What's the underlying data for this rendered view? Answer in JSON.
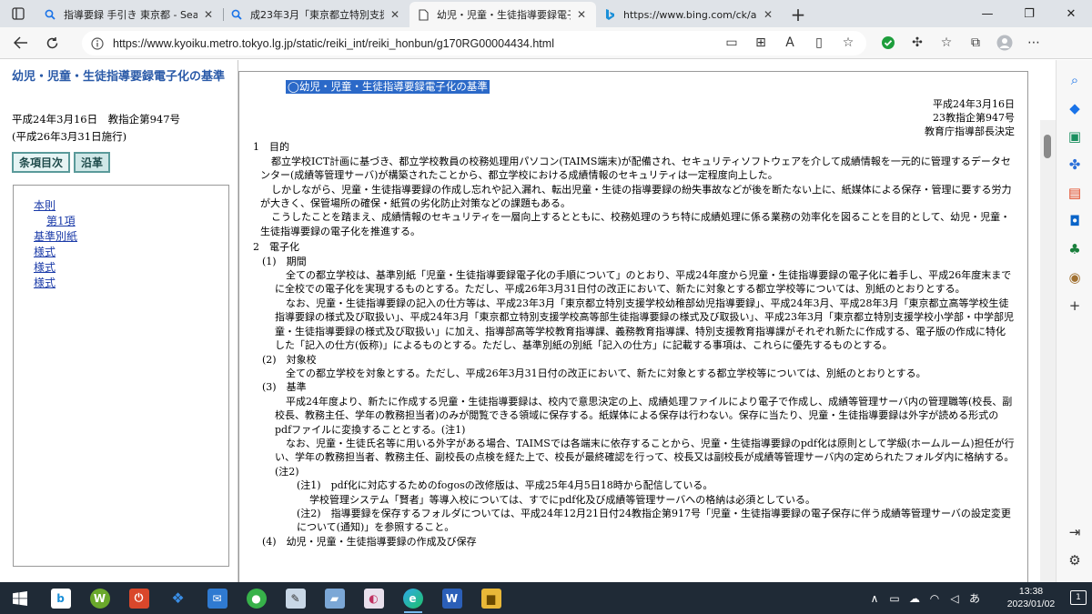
{
  "browser": {
    "tabs": [
      {
        "title": "指導要録 手引き 東京都 - Search",
        "icon": "search-icon",
        "active": false
      },
      {
        "title": "成23年3月「東京都立特別支援学校",
        "icon": "search-icon",
        "active": false
      },
      {
        "title": "幼児・児童・生徒指導要録電子化の",
        "icon": "page-icon",
        "active": true
      },
      {
        "title": "https://www.bing.com/ck/a?!&&",
        "icon": "bing-icon",
        "active": false
      }
    ],
    "url": "https://www.kyoiku.metro.tokyo.lg.jp/static/reiki_int/reiki_honbun/g170RG00004434.html"
  },
  "left": {
    "title": "幼児・児童・生徒指導要録電子化の基準",
    "date_line": "平成24年3月16日　教指企第947号",
    "enforce_line": "(平成26年3月31日施行)",
    "tab_toc": "条項目次",
    "tab_history": "沿革",
    "toc": [
      "本則",
      "第1項",
      "基準別紙",
      "様式",
      "様式",
      "様式"
    ]
  },
  "doc": {
    "title": "◯幼児・児童・生徒指導要録電子化の基準",
    "header": [
      "平成24年3月16日",
      "23教指企第947号",
      "教育庁指導部長決定"
    ],
    "s1_head": "1　目的",
    "s1_p1": "都立学校ICT計画に基づき、都立学校教員の校務処理用パソコン(TAIMS端末)が配備され、セキュリティソフトウェアを介して成績情報を一元的に管理するデータセンター(成績等管理サーバ)が構築されたことから、都立学校における成績情報のセキュリティは一定程度向上した。",
    "s1_p2": "しかしながら、児童・生徒指導要録の作成し忘れや記入漏れ、転出児童・生徒の指導要録の紛失事故などが後を断たない上に、紙媒体による保存・管理に要する労力が大きく、保管場所の確保・紙質の劣化防止対策などの課題もある。",
    "s1_p3": "こうしたことを踏まえ、成績情報のセキュリティを一層向上するとともに、校務処理のうち特に成績処理に係る業務の効率化を図ることを目的として、幼児・児童・生徒指導要録の電子化を推進する。",
    "s2_head": "2　電子化",
    "s2_1_head": "(1)　期間",
    "s2_1_p1": "全ての都立学校は、基準別紙「児童・生徒指導要録電子化の手順について」のとおり、平成24年度から児童・生徒指導要録の電子化に着手し、平成26年度末までに全校での電子化を実現するものとする。ただし、平成26年3月31日付の改正において、新たに対象とする都立学校等については、別紙のとおりとする。",
    "s2_1_p2": "なお、児童・生徒指導要録の記入の仕方等は、平成23年3月「東京都立特別支援学校幼稚部幼児指導要録」、平成24年3月、平成28年3月「東京都立高等学校生徒指導要録の様式及び取扱い」、平成24年3月「東京都立特別支援学校高等部生徒指導要録の様式及び取扱い」、平成23年3月「東京都立特別支援学校小学部・中学部児童・生徒指導要録の様式及び取扱い」に加え、指導部高等学校教育指導課、義務教育指導課、特別支援教育指導課がそれぞれ新たに作成する、電子版の作成に特化した「記入の仕方(仮称)」によるものとする。ただし、基準別紙の別紙「記入の仕方」に記載する事項は、これらに優先するものとする。",
    "s2_2_head": "(2)　対象校",
    "s2_2_p1": "全ての都立学校を対象とする。ただし、平成26年3月31日付の改正において、新たに対象とする都立学校等については、別紙のとおりとする。",
    "s2_3_head": "(3)　基準",
    "s2_3_p1": "平成24年度より、新たに作成する児童・生徒指導要録は、校内で意思決定の上、成績処理ファイルにより電子で作成し、成績等管理サーバ内の管理職等(校長、副校長、教務主任、学年の教務担当者)のみが閲覧できる領域に保存する。紙媒体による保存は行わない。保存に当たり、児童・生徒指導要録は外字が読める形式のpdfファイルに変換することとする。(注1)",
    "s2_3_p2": "なお、児童・生徒氏名等に用いる外字がある場合、TAIMSでは各端末に依存することから、児童・生徒指導要録のpdf化は原則として学級(ホームルーム)担任が行い、学年の教務担当者、教務主任、副校長の点検を経た上で、校長が最終確認を行って、校長又は副校長が成績等管理サーバ内の定められたフォルダ内に格納する。(注2)",
    "note1": "(注1)　pdf化に対応するためのfogosの改修版は、平成25年4月5日18時から配信している。",
    "note1b": "学校管理システム「賢者」等導入校については、すでにpdf化及び成績等管理サーバへの格納は必須としている。",
    "note2": "(注2)　指導要録を保存するフォルダについては、平成24年12月21日付24教指企第917号「児童・生徒指導要録の電子保存に伴う成績等管理サーバの設定変更について(通知)」を参照すること。",
    "s2_4_head": "(4)　幼児・児童・生徒指導要録の作成及び保存"
  },
  "taskbar": {
    "time": "13:38",
    "date": "2023/01/02",
    "ime": "あ"
  }
}
